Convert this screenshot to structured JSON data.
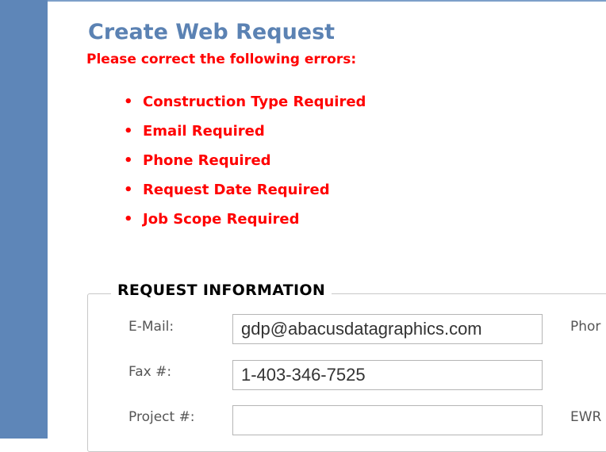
{
  "page": {
    "title": "Create Web Request",
    "error_header": "Please correct the following errors:"
  },
  "errors": [
    "Construction Type Required",
    "Email Required",
    "Phone Required",
    "Request Date Required",
    "Job Scope Required"
  ],
  "bullet": "•",
  "request_info": {
    "legend": "REQUEST INFORMATION",
    "email_label": "E-Mail:",
    "email_value": "gdp@abacusdatagraphics.com",
    "phone_label": "Phor",
    "fax_label": "Fax #:",
    "fax_value": "1-403-346-7525",
    "project_label": "Project #:",
    "project_value": "",
    "ewr_label": "EWR"
  },
  "colors": {
    "sidebar": "#5e86b8",
    "title": "#5b82b3",
    "error": "#ff0000"
  }
}
